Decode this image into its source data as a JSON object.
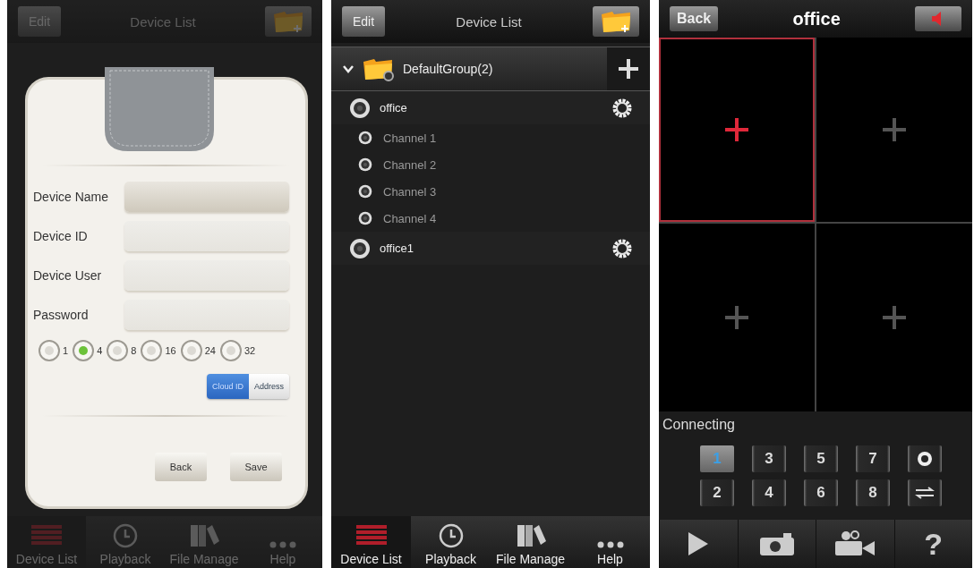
{
  "add_device_screen": {
    "dimmed": true,
    "header": {
      "left_button": "Edit",
      "title": "Device List"
    },
    "form": {
      "fields": [
        {
          "label": "Device Name",
          "selected": true
        },
        {
          "label": "Device ID",
          "selected": false
        },
        {
          "label": "Device User",
          "selected": false
        },
        {
          "label": "Password",
          "selected": false
        }
      ],
      "channel_options": [
        {
          "label": "1",
          "selected": false
        },
        {
          "label": "4",
          "selected": true
        },
        {
          "label": "8",
          "selected": false
        },
        {
          "label": "16",
          "selected": false
        },
        {
          "label": "24",
          "selected": false
        },
        {
          "label": "32",
          "selected": false
        }
      ],
      "mode_toggle": [
        {
          "label": "Cloud ID",
          "selected": true
        },
        {
          "label": "Address",
          "selected": false
        }
      ],
      "buttons": [
        "Back",
        "Save"
      ]
    },
    "tab_bar": [
      {
        "label": "Device List",
        "selected": true
      },
      {
        "label": "Playback",
        "selected": false
      },
      {
        "label": "File Manage",
        "selected": false
      },
      {
        "label": "Help",
        "selected": false
      }
    ]
  },
  "device_list_screen": {
    "header": {
      "left_button": "Edit",
      "title": "Device List"
    },
    "group": {
      "name": "DefaultGroup(2)",
      "expanded": true
    },
    "devices": [
      {
        "name": "office",
        "children": [
          {
            "name": "Channel 1"
          },
          {
            "name": "Channel 2"
          },
          {
            "name": "Channel 3"
          },
          {
            "name": "Channel 4"
          }
        ]
      },
      {
        "name": "office1"
      }
    ],
    "tab_bar": [
      {
        "label": "Device List",
        "selected": true
      },
      {
        "label": "Playback",
        "selected": false
      },
      {
        "label": "File Manage",
        "selected": false
      },
      {
        "label": "Help",
        "selected": false
      }
    ]
  },
  "live_view_screen": {
    "header": {
      "left_button": "Back",
      "title": "office"
    },
    "video_cells": [
      {
        "selected": true
      },
      {
        "selected": false
      },
      {
        "selected": false
      },
      {
        "selected": false
      }
    ],
    "status": "Connecting",
    "channel_buttons": [
      {
        "kind": "number",
        "label": "1",
        "selected": true
      },
      {
        "kind": "number",
        "label": "3",
        "selected": false
      },
      {
        "kind": "number",
        "label": "5",
        "selected": false
      },
      {
        "kind": "number",
        "label": "7",
        "selected": false
      },
      {
        "kind": "ring",
        "selected": false
      },
      {
        "kind": "number",
        "label": "2",
        "selected": false
      },
      {
        "kind": "number",
        "label": "4",
        "selected": false
      },
      {
        "kind": "number",
        "label": "6",
        "selected": false
      },
      {
        "kind": "number",
        "label": "8",
        "selected": false
      },
      {
        "kind": "arrows",
        "selected": false
      }
    ],
    "toolbar": [
      {
        "kind": "play"
      },
      {
        "kind": "camera"
      },
      {
        "kind": "video"
      },
      {
        "kind": "help",
        "label": "?"
      }
    ]
  }
}
